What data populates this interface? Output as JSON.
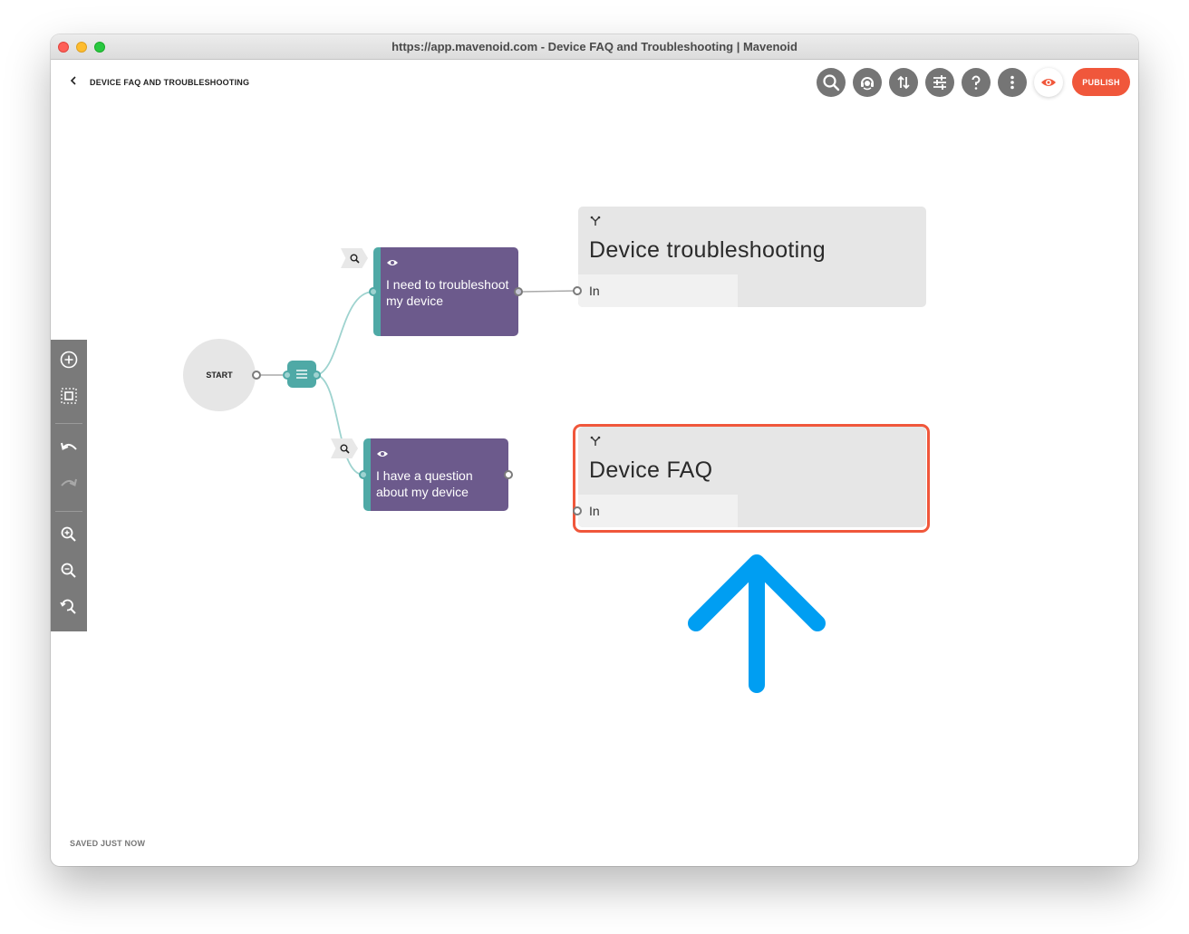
{
  "window": {
    "title": "https://app.mavenoid.com - Device FAQ and Troubleshooting | Mavenoid"
  },
  "header": {
    "page_title": "DEVICE FAQ AND TROUBLESHOOTING",
    "publish_label": "PUBLISH"
  },
  "toolbar_icons": [
    "search-icon",
    "agent-icon",
    "sort-icon",
    "sliders-icon",
    "help-icon",
    "more-icon",
    "preview-eye-icon"
  ],
  "sidebar_icons": [
    "add-node-icon",
    "select-icon",
    "undo-icon",
    "redo-icon",
    "zoom-in-icon",
    "zoom-out-icon",
    "zoom-reset-icon"
  ],
  "flow": {
    "start_label": "START",
    "choices": [
      {
        "text": "I need to troubleshoot my device"
      },
      {
        "text": "I have a question about my device"
      }
    ],
    "targets": [
      {
        "title": "Device troubleshooting",
        "input_label": "In"
      },
      {
        "title": "Device FAQ",
        "input_label": "In",
        "highlighted": true
      }
    ]
  },
  "annotation": {
    "arrow_color": "#009ef2",
    "highlight_color": "#f0573b"
  },
  "colors": {
    "accent": "#f0573b",
    "node_purple": "#6c5a8c",
    "node_teal": "#4fa9a6"
  },
  "status": {
    "save_text": "SAVED JUST NOW"
  }
}
